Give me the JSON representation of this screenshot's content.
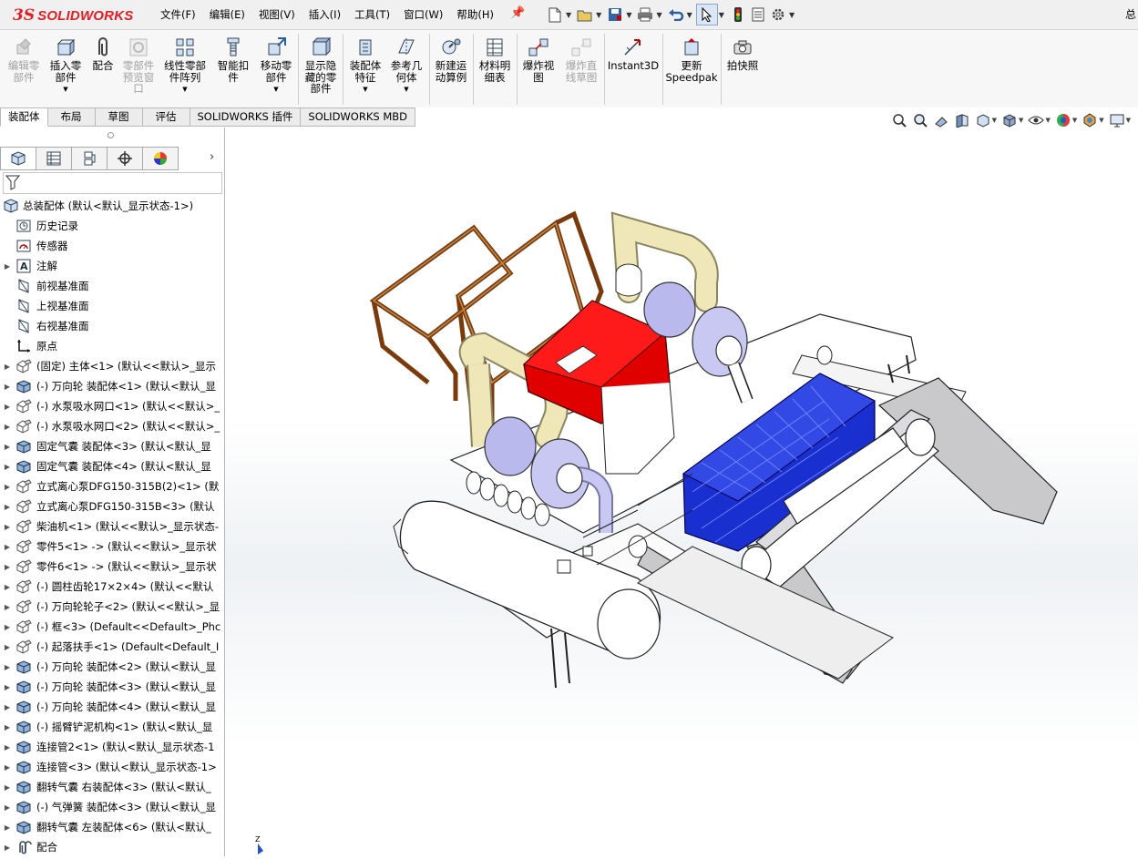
{
  "app": {
    "logo_prefix": "3S",
    "logo_name": "SOLIDWORKS",
    "title_right": "总"
  },
  "menu": [
    "文件(F)",
    "编辑(E)",
    "视图(V)",
    "插入(I)",
    "工具(T)",
    "窗口(W)",
    "帮助(H)"
  ],
  "ribbon": {
    "buttons": [
      {
        "label": "编辑零\n部件",
        "icon": "edit-component-icon",
        "enabled": false
      },
      {
        "label": "插入零\n部件",
        "icon": "insert-component-icon",
        "enabled": true
      },
      {
        "label": "配合",
        "icon": "mate-icon",
        "enabled": true
      },
      {
        "label": "零部件\n预览窗\n口",
        "icon": "component-preview-icon",
        "enabled": false
      },
      {
        "label": "线性零部\n件阵列",
        "icon": "linear-pattern-icon",
        "enabled": true
      },
      {
        "label": "智能扣\n件",
        "icon": "smart-fasteners-icon",
        "enabled": true
      },
      {
        "label": "移动零\n部件",
        "icon": "move-component-icon",
        "enabled": true
      },
      {
        "label": "显示隐\n藏的零\n部件",
        "icon": "show-hidden-icon",
        "enabled": true
      },
      {
        "label": "装配体\n特征",
        "icon": "assembly-feature-icon",
        "enabled": true
      },
      {
        "label": "参考几\n何体",
        "icon": "reference-geometry-icon",
        "enabled": true
      },
      {
        "label": "新建运\n动算例",
        "icon": "motion-study-icon",
        "enabled": true
      },
      {
        "label": "材料明\n细表",
        "icon": "bom-icon",
        "enabled": true
      },
      {
        "label": "爆炸视\n图",
        "icon": "exploded-view-icon",
        "enabled": true
      },
      {
        "label": "爆炸直\n线草图",
        "icon": "explode-line-sketch-icon",
        "enabled": false
      },
      {
        "label": "Instant3D",
        "icon": "instant3d-icon",
        "enabled": true
      },
      {
        "label": "更新\nSpeedpak",
        "icon": "speedpak-icon",
        "enabled": true
      },
      {
        "label": "拍快照",
        "icon": "snapshot-icon",
        "enabled": true
      }
    ]
  },
  "tabs": [
    "装配体",
    "布局",
    "草图",
    "评估",
    "SOLIDWORKS 插件",
    "SOLIDWORKS MBD"
  ],
  "tree": {
    "root": "总装配体  (默认<默认_显示状态-1>)",
    "items": [
      {
        "label": "历史记录",
        "icon": "history-icon",
        "expand": false
      },
      {
        "label": "传感器",
        "icon": "sensor-icon",
        "expand": false
      },
      {
        "label": "注解",
        "icon": "annotation-icon",
        "expand": true
      },
      {
        "label": "前视基准面",
        "icon": "plane-icon",
        "expand": false
      },
      {
        "label": "上视基准面",
        "icon": "plane-icon",
        "expand": false
      },
      {
        "label": "右视基准面",
        "icon": "plane-icon",
        "expand": false
      },
      {
        "label": "原点",
        "icon": "origin-icon",
        "expand": false
      },
      {
        "label": "(固定) 主体<1> (默认<<默认>_显示",
        "icon": "part-icon",
        "expand": true
      },
      {
        "label": "(-) 万向轮  装配体<1> (默认<默认_显",
        "icon": "subassembly-icon",
        "expand": true
      },
      {
        "label": "(-) 水泵吸水网口<1> (默认<<默认>_",
        "icon": "part-icon",
        "expand": true
      },
      {
        "label": "(-) 水泵吸水网口<2> (默认<<默认>_",
        "icon": "part-icon",
        "expand": true
      },
      {
        "label": "固定气囊 装配体<3> (默认<默认_显",
        "icon": "subassembly-icon",
        "expand": true
      },
      {
        "label": "固定气囊 装配体<4> (默认<默认_显",
        "icon": "subassembly-icon",
        "expand": true
      },
      {
        "label": "立式离心泵DFG150-315B(2)<1> (默",
        "icon": "part-icon",
        "expand": true
      },
      {
        "label": "立式离心泵DFG150-315B<3> (默认",
        "icon": "part-icon",
        "expand": true
      },
      {
        "label": "柴油机<1> (默认<<默认>_显示状态-",
        "icon": "part-icon",
        "expand": true
      },
      {
        "label": "零件5<1> -> (默认<<默认>_显示状",
        "icon": "part-icon",
        "expand": true
      },
      {
        "label": "零件6<1> -> (默认<<默认>_显示状",
        "icon": "part-icon",
        "expand": true
      },
      {
        "label": "(-) 圆柱齿轮17×2×4> (默认<<默认",
        "icon": "part-icon",
        "expand": true
      },
      {
        "label": "(-) 万向轮轮子<2> (默认<<默认>_显",
        "icon": "part-icon",
        "expand": true
      },
      {
        "label": "(-) 框<3> (Default<<Default>_Phc",
        "icon": "part-icon",
        "expand": true
      },
      {
        "label": "(-) 起落扶手<1> (Default<Default_I",
        "icon": "part-icon",
        "expand": true
      },
      {
        "label": "(-) 万向轮  装配体<2> (默认<默认_显",
        "icon": "subassembly-icon",
        "expand": true
      },
      {
        "label": "(-) 万向轮  装配体<3> (默认<默认_显",
        "icon": "subassembly-icon",
        "expand": true
      },
      {
        "label": "(-) 万向轮  装配体<4> (默认<默认_显",
        "icon": "subassembly-icon",
        "expand": true
      },
      {
        "label": "(-) 摇臂铲泥机构<1> (默认<默认_显",
        "icon": "subassembly-icon",
        "expand": true
      },
      {
        "label": "连接管2<1> (默认<默认_显示状态-1",
        "icon": "subassembly-icon",
        "expand": true
      },
      {
        "label": "连接管<3> (默认<默认_显示状态-1>",
        "icon": "subassembly-icon",
        "expand": true
      },
      {
        "label": "翻转气囊 右装配体<3> (默认<默认_",
        "icon": "subassembly-icon",
        "expand": true
      },
      {
        "label": "(-) 气弹簧 装配体<3> (默认<默认_显",
        "icon": "subassembly-icon",
        "expand": true
      },
      {
        "label": "翻转气囊 左装配体<6> (默认<默认_",
        "icon": "subassembly-icon",
        "expand": true
      },
      {
        "label": "配合",
        "icon": "mates-folder-icon",
        "expand": true
      }
    ]
  },
  "colors": {
    "engine": "#ff0000",
    "basket": "#1a2fd0",
    "frame": "#9a4a12",
    "pump": "#b9b9ee",
    "pipe": "#efe7b8"
  }
}
